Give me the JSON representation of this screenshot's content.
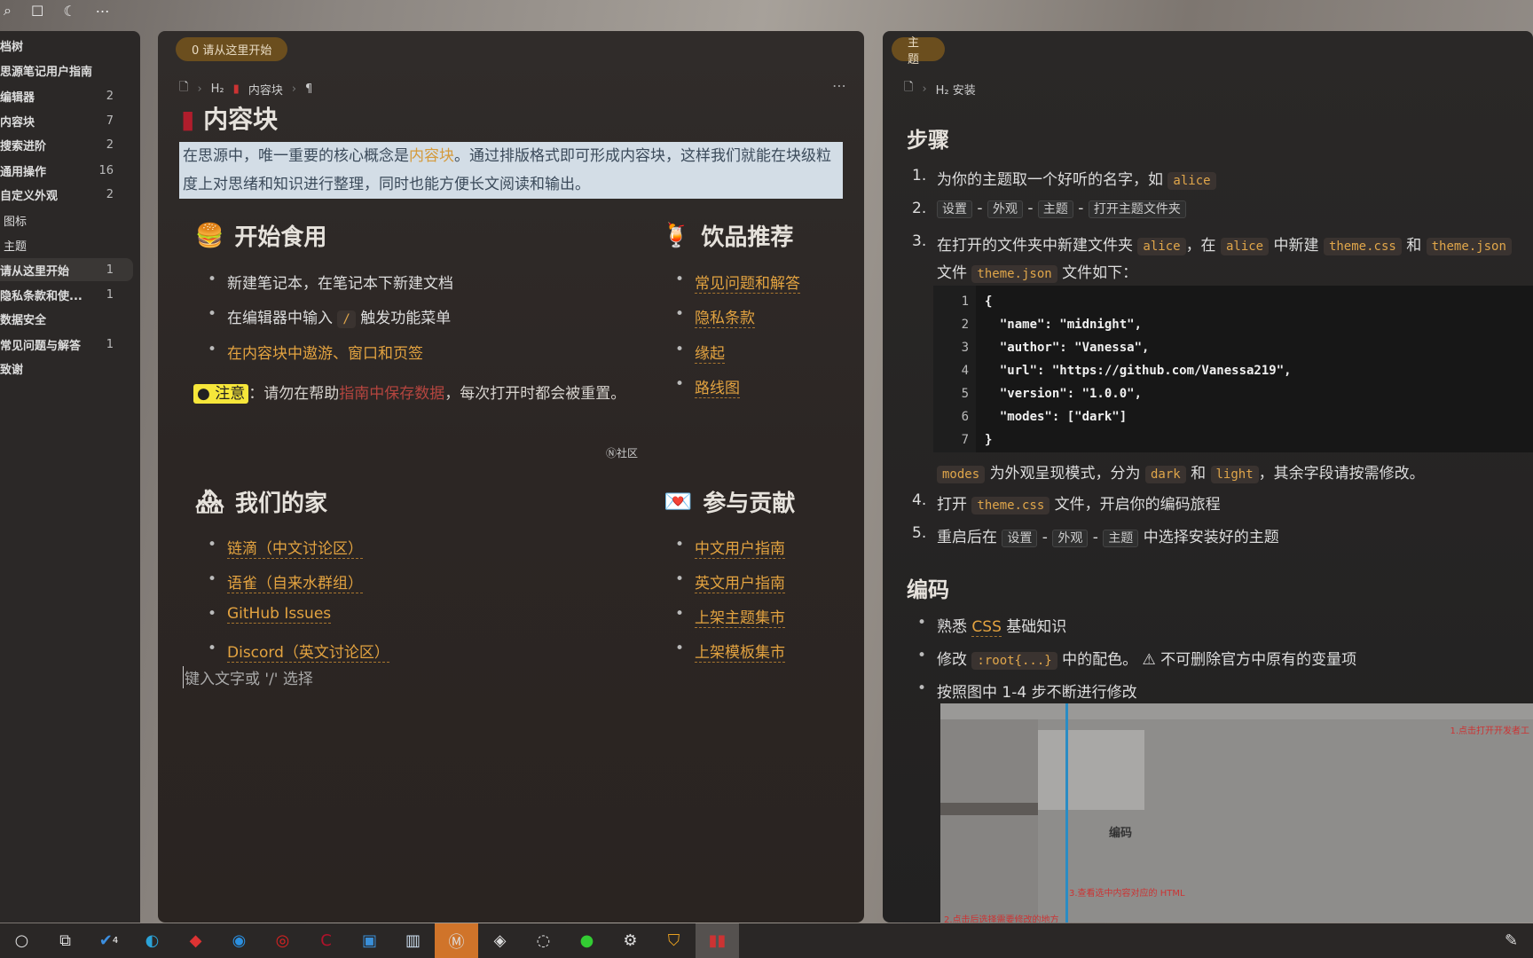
{
  "sidebar": {
    "items": [
      {
        "label": "档树",
        "count": ""
      },
      {
        "label": "思源笔记用户指南",
        "count": ""
      },
      {
        "label": "编辑器",
        "count": "2"
      },
      {
        "label": "内容块",
        "count": "7"
      },
      {
        "label": "搜索进阶",
        "count": "2"
      },
      {
        "label": "通用操作",
        "count": "16"
      },
      {
        "label": "自定义外观",
        "count": "2"
      },
      {
        "label": "图标",
        "count": ""
      },
      {
        "label": "主题",
        "count": ""
      },
      {
        "label": "请从这里开始",
        "count": "1"
      },
      {
        "label": "隐私条款和使...",
        "count": "1"
      },
      {
        "label": "数据安全",
        "count": ""
      },
      {
        "label": "常见问题与解答",
        "count": "1"
      },
      {
        "label": "致谢",
        "count": ""
      }
    ]
  },
  "left_doc": {
    "tab": "0 请从这里开始",
    "breadcrumb": [
      "H₂",
      "内容块",
      "¶"
    ],
    "title": "内容块",
    "intro_a": "在思源中，唯一重要的核心概念是",
    "intro_kw": "内容块",
    "intro_b": "。通过排版格式即可形成内容块，这样我们就能在块级粒度上对思绪和知识进行整理，同时也能方便长文阅读和输出。",
    "start": {
      "heading": "开始食用",
      "items": [
        "新建笔记本，在笔记本下新建文档",
        "在编辑器中输入",
        "/",
        "触发功能菜单",
        "在内容块中遨游、窗口和页签"
      ]
    },
    "drinks": {
      "heading": "饮品推荐",
      "items": [
        "常见问题和解答",
        "隐私条款",
        "缘起",
        "路线图"
      ]
    },
    "note": {
      "badge": "● 注意",
      "text_a": "：请勿在帮助",
      "text_b": "指南中保存数据",
      "text_c": "，每次打开时都会被重置。"
    },
    "community": "Ⓝ社区",
    "home": {
      "heading": "我们的家",
      "items": [
        "链滴（中文讨论区）",
        "语雀（自来水群组）",
        "GitHub Issues",
        "Discord（英文讨论区）"
      ]
    },
    "contrib": {
      "heading": "参与贡献",
      "items": [
        "中文用户指南",
        "英文用户指南",
        "上架主题集市",
        "上架模板集市"
      ]
    },
    "placeholder": "键入文字或 '/' 选择"
  },
  "right_doc": {
    "tab": "主题",
    "breadcrumb": [
      "H₂ 安装"
    ],
    "steps_heading": "步骤",
    "s1": "为你的主题取一个好听的名字，如",
    "alice": "alice",
    "s2": [
      "设置",
      "外观",
      "主题",
      "打开主题文件夹"
    ],
    "s3a": "在打开的文件夹中新建文件夹",
    "s3b": "，在",
    "s3c": "中新建",
    "themecss": "theme.css",
    "and": "和",
    "themejson": "theme.json",
    "s3d": "文件",
    "s3e": "文件如下：",
    "code": [
      "{",
      "  \"name\": \"midnight\",",
      "  \"author\": \"Vanessa\",",
      "  \"url\": \"https://github.com/Vanessa219\",",
      "  \"version\": \"1.0.0\",",
      "  \"modes\": [\"dark\"]",
      "}"
    ],
    "modes_a": "modes",
    "modes_b": "为外观呈现模式，分为",
    "dark": "dark",
    "light": "light",
    "modes_c": "，其余字段请按需修改。",
    "s4a": "打开",
    "s4b": "文件，开启你的编码旅程",
    "s5a": "重启后在",
    "s5b": "中选择安装好的主题",
    "coding_heading": "编码",
    "c1a": "熟悉",
    "css": "CSS",
    "c1b": "基础知识",
    "c2a": "修改",
    ":root": ":root{...}",
    "c2b": "中的配色。",
    "c2warn": "⚠ 不可删除官方中原有的变量项",
    "c3": "按照图中 1-4 步不断进行修改",
    "shot_labels": [
      "1.点击打开开发者工",
      "2.点击后选择需要修改的地方",
      "3.查看选中内容对应的 HTML",
      "编码"
    ]
  },
  "taskbar": {
    "badge": "4"
  }
}
